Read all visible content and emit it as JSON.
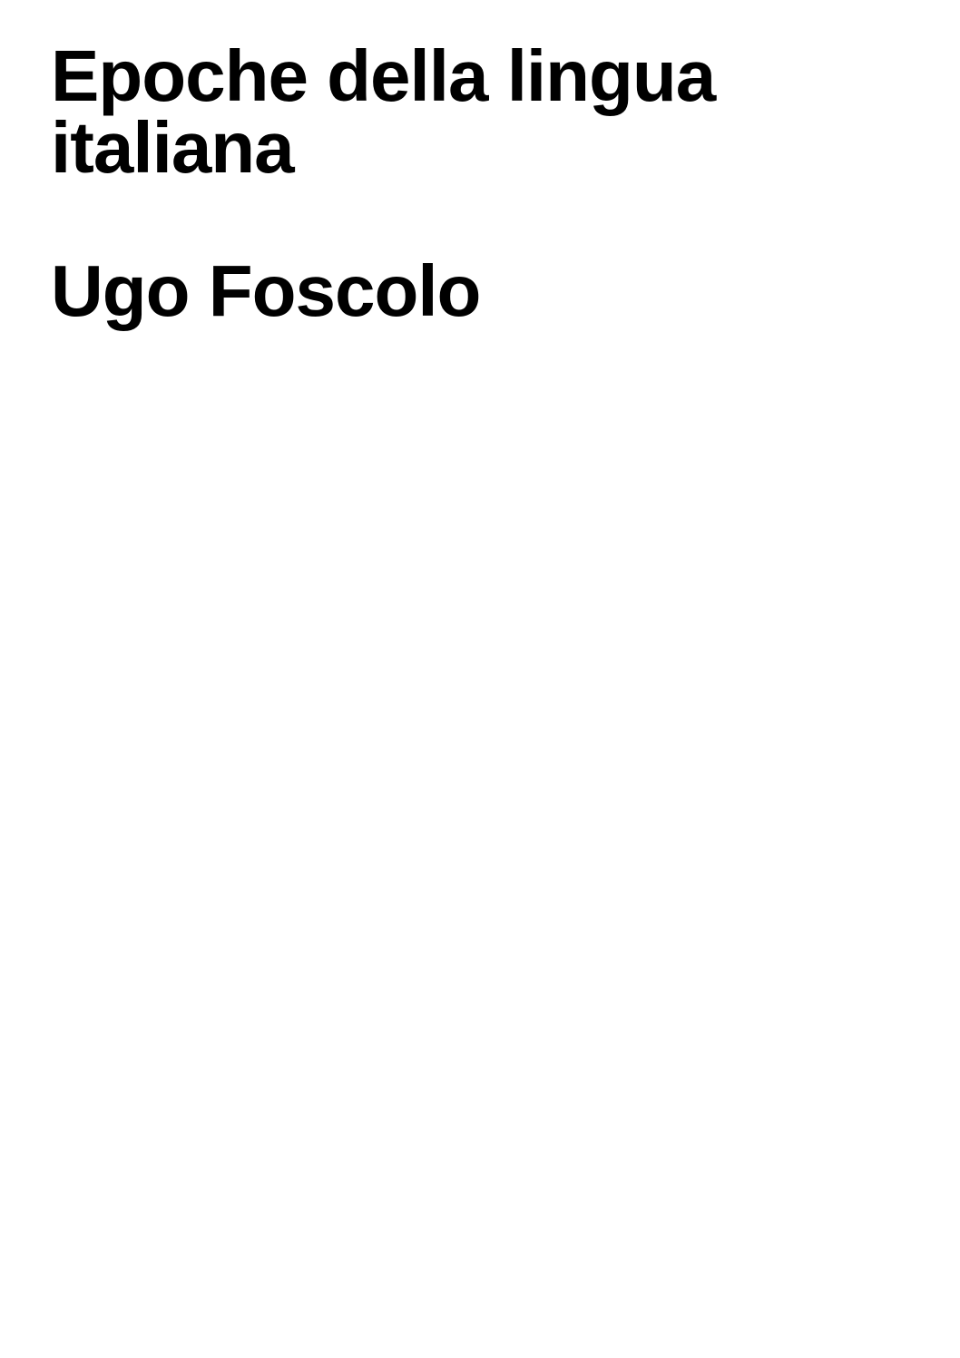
{
  "cover": {
    "title": "Epoche della lingua italiana",
    "author": "Ugo Foscolo"
  }
}
